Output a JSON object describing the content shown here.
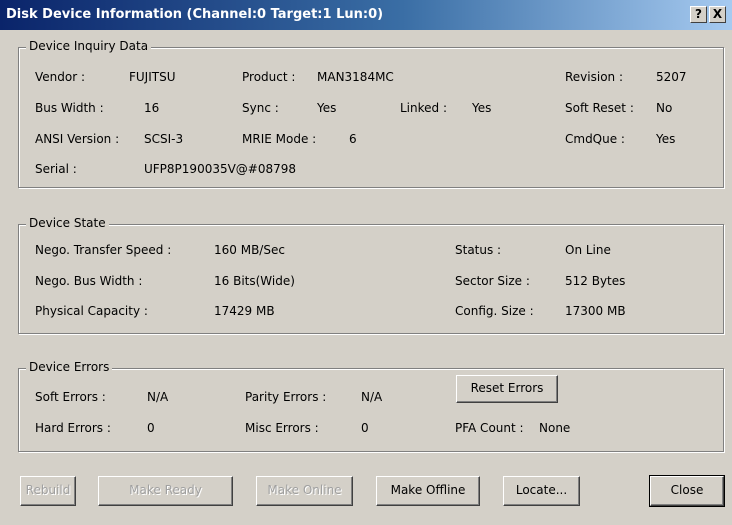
{
  "window": {
    "title": "Disk Device Information (Channel:0 Target:1 Lun:0)",
    "help_label": "?",
    "close_label": "X"
  },
  "inquiry": {
    "legend": "Device Inquiry Data",
    "vendor_label": "Vendor :",
    "vendor": "FUJITSU",
    "product_label": "Product :",
    "product": "MAN3184MC",
    "revision_label": "Revision :",
    "revision": "5207",
    "bus_width_label": "Bus Width :",
    "bus_width": "16",
    "sync_label": "Sync :",
    "sync": "Yes",
    "linked_label": "Linked :",
    "linked": "Yes",
    "soft_reset_label": "Soft Reset :",
    "soft_reset": "No",
    "ansi_label": "ANSI Version :",
    "ansi": "SCSI-3",
    "mrie_label": "MRIE Mode :",
    "mrie": "6",
    "cmdque_label": "CmdQue :",
    "cmdque": "Yes",
    "serial_label": "Serial :",
    "serial": "UFP8P190035V@#08798"
  },
  "state": {
    "legend": "Device State",
    "speed_label": "Nego. Transfer Speed :",
    "speed": "160 MB/Sec",
    "status_label": "Status :",
    "status": "On Line",
    "buswidth_label": "Nego. Bus Width :",
    "buswidth": "16 Bits(Wide)",
    "sector_label": "Sector Size :",
    "sector": "512 Bytes",
    "capacity_label": "Physical Capacity :",
    "capacity": "17429 MB",
    "config_label": "Config. Size :",
    "config": "17300 MB"
  },
  "errors": {
    "legend": "Device Errors",
    "soft_label": "Soft Errors :",
    "soft": "N/A",
    "parity_label": "Parity Errors :",
    "parity": "N/A",
    "hard_label": "Hard Errors :",
    "hard": "0",
    "misc_label": "Misc Errors :",
    "misc": "0",
    "pfa_label": "PFA Count :",
    "pfa": "None",
    "reset_button": "Reset Errors"
  },
  "buttons": {
    "rebuild": "Rebuild",
    "make_ready": "Make Ready",
    "make_online": "Make Online",
    "make_offline": "Make Offline",
    "locate": "Locate...",
    "close": "Close"
  }
}
